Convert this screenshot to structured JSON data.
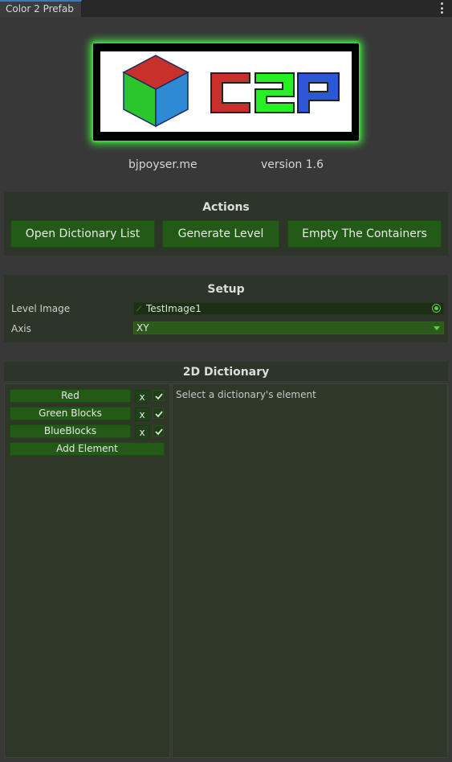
{
  "tab": {
    "title": "Color 2 Prefab",
    "menu_icon": "kebab-menu-icon"
  },
  "logo": {
    "text": "C2P",
    "colors": {
      "c": "#c8302b",
      "two": "#24d624",
      "p": "#2c58d8",
      "glow": "#3ee63a"
    }
  },
  "meta": {
    "site": "bjpoyser.me",
    "version": "version 1.6"
  },
  "actions": {
    "title": "Actions",
    "buttons": [
      "Open Dictionary List",
      "Generate Level",
      "Empty The Containers"
    ]
  },
  "setup": {
    "title": "Setup",
    "level_image_label": "Level Image",
    "level_image_value": "TestImage1",
    "axis_label": "Axis",
    "axis_value": "XY"
  },
  "dictionary": {
    "title": "2D Dictionary",
    "elements": [
      {
        "name": "Red",
        "remove": "x",
        "enabled": true
      },
      {
        "name": "Green Blocks",
        "remove": "x",
        "enabled": true
      },
      {
        "name": "BlueBlocks",
        "remove": "x",
        "enabled": true
      }
    ],
    "add_label": "Add Element",
    "detail_hint": "Select a dictionary's element"
  },
  "colors": {
    "accent_button": "#245a18",
    "panel": "#2d3529",
    "tab_accent": "#3a79bb"
  }
}
